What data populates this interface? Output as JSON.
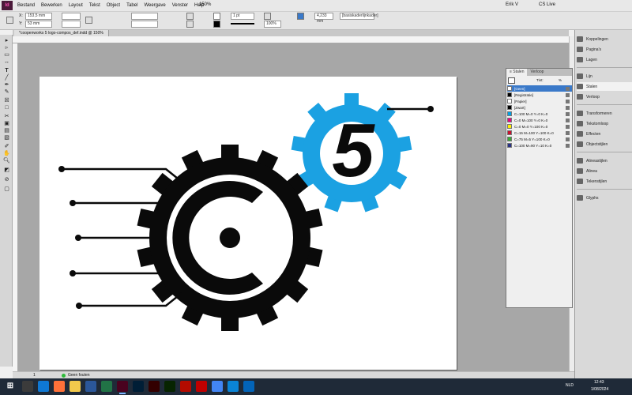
{
  "menu": {
    "app_logo": "Id",
    "items": [
      "Bestand",
      "Bewerken",
      "Layout",
      "Tekst",
      "Object",
      "Tabel",
      "Weergave",
      "Venster",
      "Help"
    ],
    "zoom": "150%",
    "user": "Erik V",
    "cs_live": "CS Live"
  },
  "control": {
    "x": "153,5 mm",
    "y": "53 mm",
    "stroke_weight": "1 pt",
    "opacity": "100%",
    "width_value": "4,233 mm",
    "frame_style": "[basiskaderlijnkader]",
    "percent": "100%"
  },
  "document": {
    "tab_title": "*coopenworks 5 logo-compos_def.indd @ 150%"
  },
  "status": {
    "page": "1",
    "preflight": "Geen fouten"
  },
  "swatches_panel": {
    "tabs": [
      "≡ Stalen",
      "Verloop"
    ],
    "tint_label": "Tint:",
    "tint_value": "%",
    "rows": [
      {
        "name": "[Geen]",
        "color": "#ffffff",
        "selected": true
      },
      {
        "name": "[Registratie]",
        "color": "#000000",
        "selected": false
      },
      {
        "name": "[Papier]",
        "color": "#ffffff",
        "selected": false
      },
      {
        "name": "[Zwart]",
        "color": "#000000",
        "selected": false
      },
      {
        "name": "C=100 M=0 Y=0 K=0",
        "color": "#00a0e4",
        "selected": false
      },
      {
        "name": "C=0 M=100 Y=0 K=0",
        "color": "#e6007e",
        "selected": false
      },
      {
        "name": "C=0 M=0 Y=100 K=0",
        "color": "#ffed00",
        "selected": false
      },
      {
        "name": "C=15 M=100 Y=100 K=0",
        "color": "#c8102e",
        "selected": false
      },
      {
        "name": "C=75 M=5 Y=100 K=0",
        "color": "#3aa935",
        "selected": false
      },
      {
        "name": "C=100 M=90 Y=10 K=0",
        "color": "#2a3384",
        "selected": false
      }
    ]
  },
  "dock": {
    "groups": [
      [
        "Koppelingen",
        "Pagina's",
        "Lagen"
      ],
      [
        "Lijn",
        "Stalen",
        "Verloop"
      ],
      [
        "Transformeren",
        "Tekstomloop",
        "Effecten",
        "Objectstijlen"
      ],
      [
        "Alineastijlen",
        "Alinea",
        "Tekenstijlen"
      ],
      [
        "Glyphs"
      ]
    ],
    "selected": "Stalen"
  },
  "taskbar": {
    "time": "12:43",
    "date": "1/08/2024",
    "lang": "NLD",
    "apps": [
      "search",
      "edge",
      "firefox",
      "explorer",
      "word",
      "excel",
      "indesign",
      "photoshop",
      "illustrator",
      "dreamweaver",
      "acrobat",
      "filezilla",
      "chrome",
      "edge2",
      "outlook"
    ]
  },
  "logo": {
    "numeral": "5",
    "colors": {
      "black": "#0a0a0a",
      "blue": "#1ba1e2",
      "white": "#ffffff"
    }
  }
}
